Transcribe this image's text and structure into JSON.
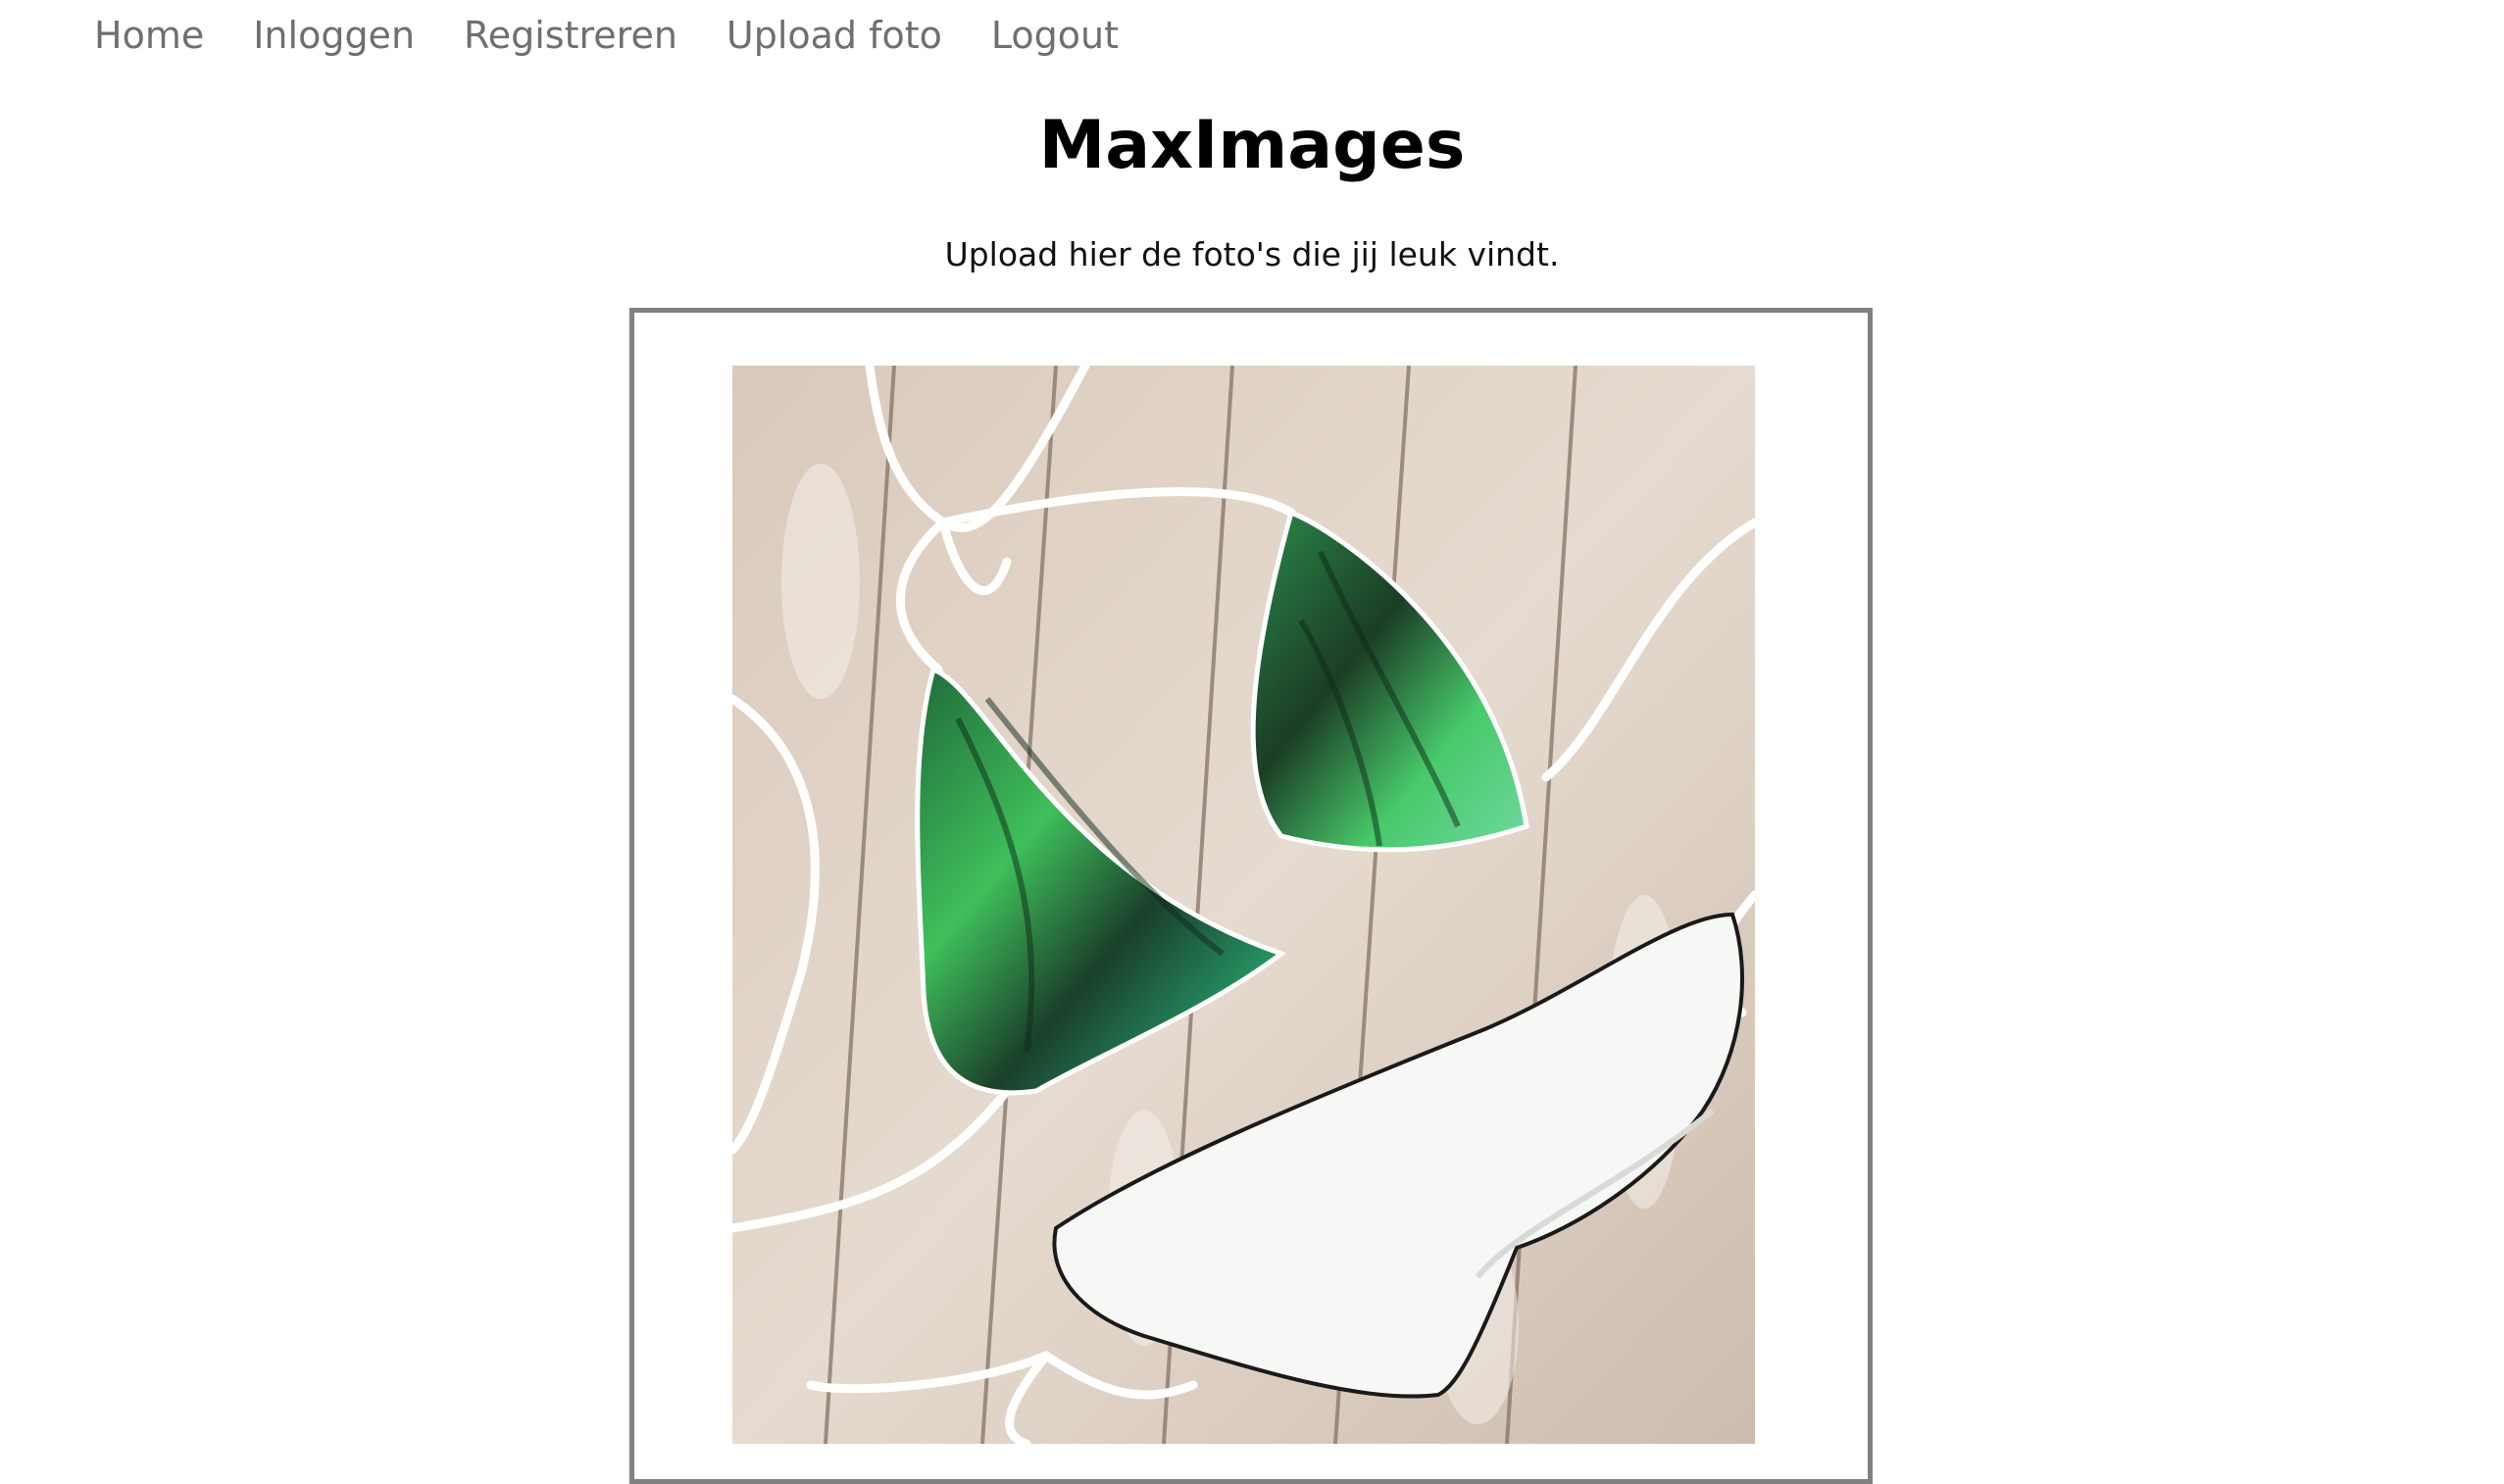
{
  "nav": {
    "items": [
      {
        "label": "Home"
      },
      {
        "label": "Inloggen"
      },
      {
        "label": "Registreren"
      },
      {
        "label": "Upload foto"
      },
      {
        "label": "Logout"
      }
    ]
  },
  "header": {
    "title": "MaxImages",
    "subtitle": "Upload hier de foto's die jij leuk vindt."
  },
  "colors": {
    "nav_text": "#6f6f6f",
    "frame_border": "#808080",
    "background": "#ffffff"
  }
}
